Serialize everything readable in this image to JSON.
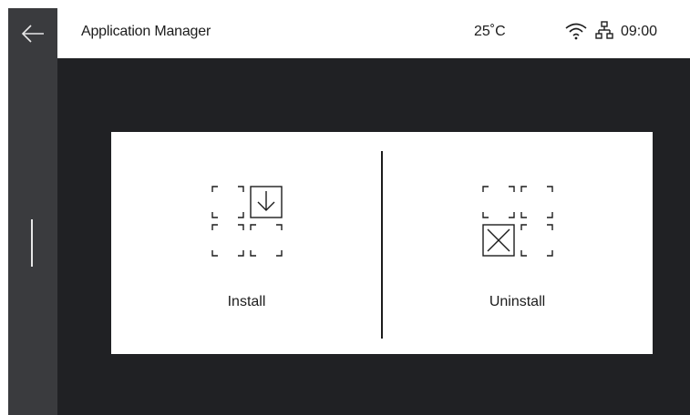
{
  "header": {
    "title": "Application Manager",
    "temperature": "25˚C",
    "time": "09:00",
    "status_icons": [
      "wifi-icon",
      "ethernet-icon"
    ]
  },
  "nav": {
    "back_icon": "arrow-left-icon"
  },
  "actions": [
    {
      "label": "Install",
      "icon": "grid-download-icon"
    },
    {
      "label": "Uninstall",
      "icon": "grid-remove-icon"
    }
  ],
  "colors": {
    "background": "#202124",
    "rail": "#3a3b3e",
    "panel": "#ffffff",
    "text": "#1c1c1c"
  }
}
